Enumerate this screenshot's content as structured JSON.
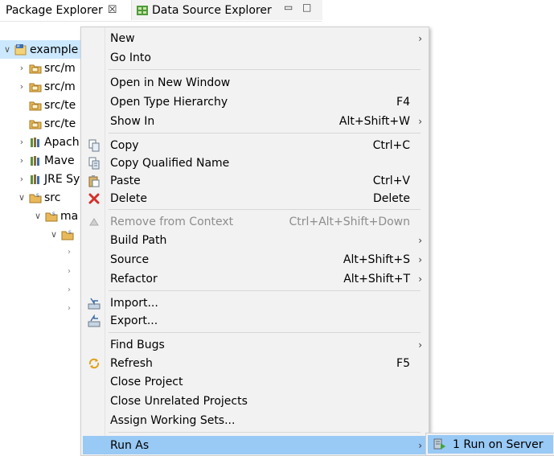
{
  "tabs": {
    "package_explorer": "Package Explorer",
    "close_glyph": "☒",
    "data_source_explorer": "Data Source Explorer",
    "minimize_glyph": "▭",
    "maximize_glyph": "□"
  },
  "tree": {
    "items": [
      {
        "label": "example",
        "chev": "∨"
      },
      {
        "label": "src/m",
        "chev": "›"
      },
      {
        "label": "src/m",
        "chev": "›"
      },
      {
        "label": "src/te",
        "chev": ""
      },
      {
        "label": "src/te",
        "chev": ""
      },
      {
        "label": "Apach",
        "chev": "›"
      },
      {
        "label": "Mave",
        "chev": "›"
      },
      {
        "label": "JRE Sy",
        "chev": "›"
      },
      {
        "label": "src",
        "chev": "∨"
      },
      {
        "label": "ma",
        "chev": "∨"
      },
      {
        "label": "",
        "chev": "∨"
      }
    ]
  },
  "menu": {
    "new": "New",
    "go_into": "Go Into",
    "open_new_window": "Open in New Window",
    "open_type_hierarchy": "Open Type Hierarchy",
    "open_type_hierarchy_key": "F4",
    "show_in": "Show In",
    "show_in_key": "Alt+Shift+W",
    "copy": "Copy",
    "copy_key": "Ctrl+C",
    "copy_qualified": "Copy Qualified Name",
    "paste": "Paste",
    "paste_key": "Ctrl+V",
    "delete": "Delete",
    "delete_key": "Delete",
    "remove_context": "Remove from Context",
    "remove_context_key": "Ctrl+Alt+Shift+Down",
    "build_path": "Build Path",
    "source": "Source",
    "source_key": "Alt+Shift+S",
    "refactor": "Refactor",
    "refactor_key": "Alt+Shift+T",
    "import": "Import...",
    "export": "Export...",
    "find_bugs": "Find Bugs",
    "refresh": "Refresh",
    "refresh_key": "F5",
    "close_project": "Close Project",
    "close_unrelated": "Close Unrelated Projects",
    "assign_working_sets": "Assign Working Sets...",
    "run_as": "Run As",
    "arrow": "›"
  },
  "submenu": {
    "run_on_server": "1 Run on Server"
  }
}
